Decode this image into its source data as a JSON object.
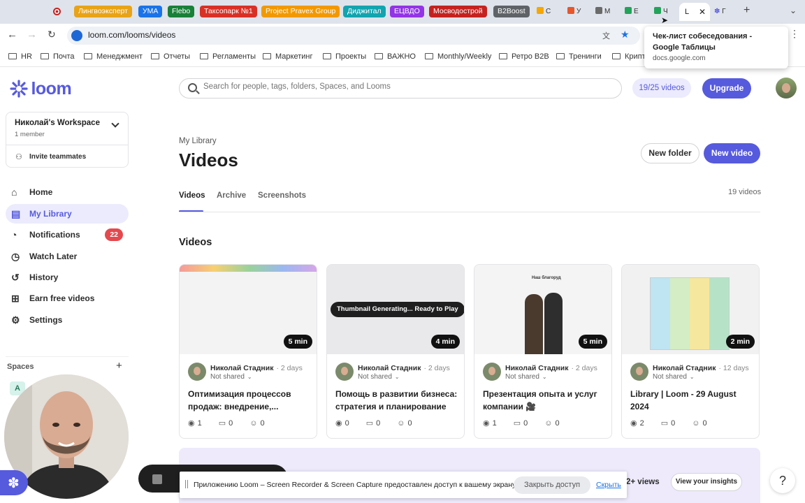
{
  "browser": {
    "group_tabs": [
      {
        "label": "Лингвоэксперт",
        "color": "#e8a317"
      },
      {
        "label": "УМА",
        "color": "#1a73e8"
      },
      {
        "label": "Flebo",
        "color": "#188038"
      },
      {
        "label": "Таксопарк №1",
        "color": "#d93025"
      },
      {
        "label": "Project Pravex Group",
        "color": "#f29900"
      },
      {
        "label": "Диджитал",
        "color": "#12a4af"
      },
      {
        "label": "ЕЦВДО",
        "color": "#9334e6"
      },
      {
        "label": "Мосводострой",
        "color": "#c5221f"
      },
      {
        "label": "B2Boost",
        "color": "#5f6368"
      }
    ],
    "small_tabs": [
      "С",
      "У",
      "М",
      "Е",
      "Ч"
    ],
    "active_tab": "L",
    "last_tab": "Г",
    "url": "loom.com/looms/videos",
    "bookmarks": [
      "HR",
      "Почта",
      "Менеджмент",
      "Отчеты",
      "Регламенты",
      "Маркетинг",
      "Проекты",
      "ВАЖНО",
      "Monthly/Weekly",
      "Ретро B2B",
      "Тренинги",
      "Крипт"
    ],
    "tooltip": {
      "title": "Чек-лист собеседования - Google Таблицы",
      "url": "docs.google.com"
    }
  },
  "sidebar": {
    "logo": "loom",
    "workspace_name": "Николай's Workspace",
    "members": "1 member",
    "invite": "Invite teammates",
    "nav": [
      {
        "label": "Home",
        "icon": "home-icon"
      },
      {
        "label": "My Library",
        "icon": "library-icon"
      },
      {
        "label": "Notifications",
        "icon": "bell-icon",
        "badge": "22"
      },
      {
        "label": "Watch Later",
        "icon": "clock-icon"
      },
      {
        "label": "History",
        "icon": "history-icon"
      },
      {
        "label": "Earn free videos",
        "icon": "gift-icon"
      },
      {
        "label": "Settings",
        "icon": "gear-icon"
      }
    ],
    "spaces_label": "Spaces",
    "space_initial": "A"
  },
  "header": {
    "search_placeholder": "Search for people, tags, folders, Spaces, and Looms",
    "quota": "19/25 videos",
    "upgrade": "Upgrade"
  },
  "main": {
    "breadcrumb": "My Library",
    "title": "Videos",
    "new_folder": "New folder",
    "new_video": "New video",
    "tabs": [
      "Videos",
      "Archive",
      "Screenshots"
    ],
    "count": "19 videos",
    "section": "Videos",
    "videos": [
      {
        "duration": "5 min",
        "author": "Николай Стадник",
        "age": "· 2 days",
        "share": "Not shared",
        "title": "Оптимизация процессов продаж: внедрение,...",
        "views": "1",
        "comments": "0",
        "reactions": "0"
      },
      {
        "duration": "4 min",
        "author": "Николай Стадник",
        "age": "· 2 days",
        "share": "Not shared",
        "title": "Помощь в развитии бизнеса: стратегия и планирование",
        "views": "0",
        "comments": "0",
        "reactions": "0",
        "overlay": "Thumbnail Generating... Ready to Play"
      },
      {
        "duration": "5 min",
        "author": "Николай Стадник",
        "age": "· 2 days",
        "share": "Not shared",
        "title": "Презентация опыта и услуг компании 🎥",
        "views": "1",
        "comments": "0",
        "reactions": "0",
        "thumb_caption": "Наш благоруд"
      },
      {
        "duration": "2 min",
        "author": "Николай Стадник",
        "age": "· 12 days",
        "share": "Not shared",
        "title": "Library | Loom - 29 August 2024",
        "views": "2",
        "comments": "0",
        "reactions": "0"
      }
    ],
    "insights": {
      "views": "2+ views",
      "button": "View your insights"
    }
  },
  "share_bar": {
    "text": "Приложению Loom – Screen Recorder & Screen Capture предоставлен доступ к вашему экрану.",
    "stop": "Закрыть доступ",
    "hide": "Скрыть"
  },
  "help": "?",
  "colors": {
    "brand": "#565add",
    "badge": "#e5484d"
  }
}
